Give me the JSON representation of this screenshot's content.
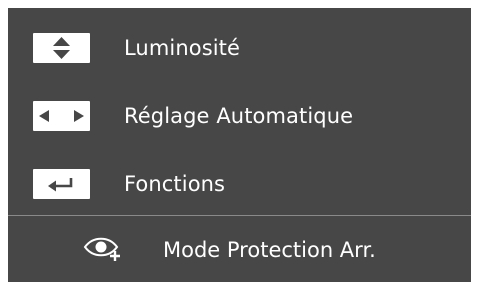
{
  "menu": {
    "items": [
      {
        "icon": "up-down-arrows-icon",
        "label": "Luminosité"
      },
      {
        "icon": "left-right-arrows-icon",
        "label": "Réglage Automatique"
      },
      {
        "icon": "enter-return-icon",
        "label": "Fonctions"
      }
    ],
    "bottom": {
      "icon": "eye-saver-icon",
      "label": "Mode Protection Arr."
    }
  },
  "colors": {
    "background": "#474747",
    "text": "#ffffff",
    "keycap": "#ffffff",
    "glyph": "#474747",
    "divider": "#8a8a8a"
  }
}
